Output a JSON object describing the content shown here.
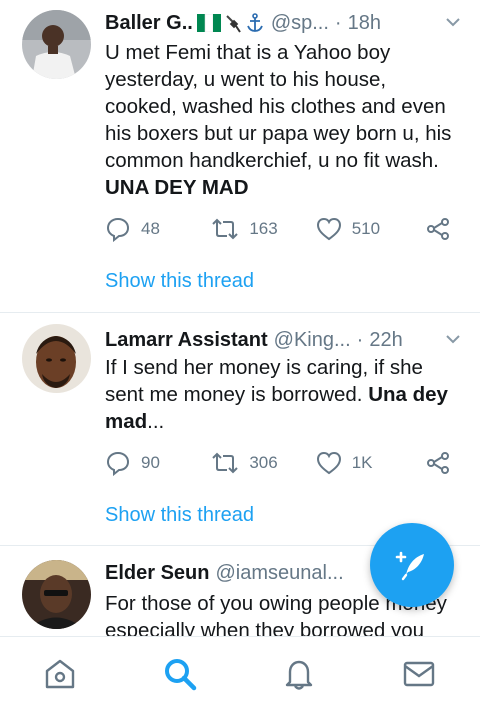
{
  "tweets": [
    {
      "name": "Baller G..",
      "handle": "@sp...",
      "time": "18h",
      "body": "U met Femi that is a Yahoo boy yesterday, u went to his house, cooked, washed his clothes and even his boxers but ur papa wey born u, his common handkerchief, u no fit wash. ",
      "body_bold": "UNA DEY MAD",
      "replies": "48",
      "retweets": "163",
      "likes": "510",
      "show_thread": "Show this thread"
    },
    {
      "name": "Lamarr Assistant",
      "handle": "@King...",
      "time": "22h",
      "body": "If I send her money is caring, if she sent me money is borrowed. ",
      "body_bold": "Una dey mad",
      "body_tail": "...",
      "replies": "90",
      "retweets": "306",
      "likes": "1K",
      "show_thread": "Show this thread"
    },
    {
      "name": "Elder Seun",
      "handle": "@iamseunal...",
      "body": "For those of you owing people money especially when they borrowed you"
    }
  ],
  "icons": {
    "reply": "reply-icon",
    "retweet": "retweet-icon",
    "like": "heart-icon",
    "share": "share-icon",
    "caret": "chevron-down-icon",
    "compose": "compose-tweet-icon",
    "home": "home-icon",
    "search": "search-icon",
    "notifications": "bell-icon",
    "messages": "mail-icon"
  },
  "colors": {
    "accent": "#1da1f2",
    "secondary_text": "#657786",
    "primary_text": "#14171a",
    "divider": "#e6ecf0"
  }
}
